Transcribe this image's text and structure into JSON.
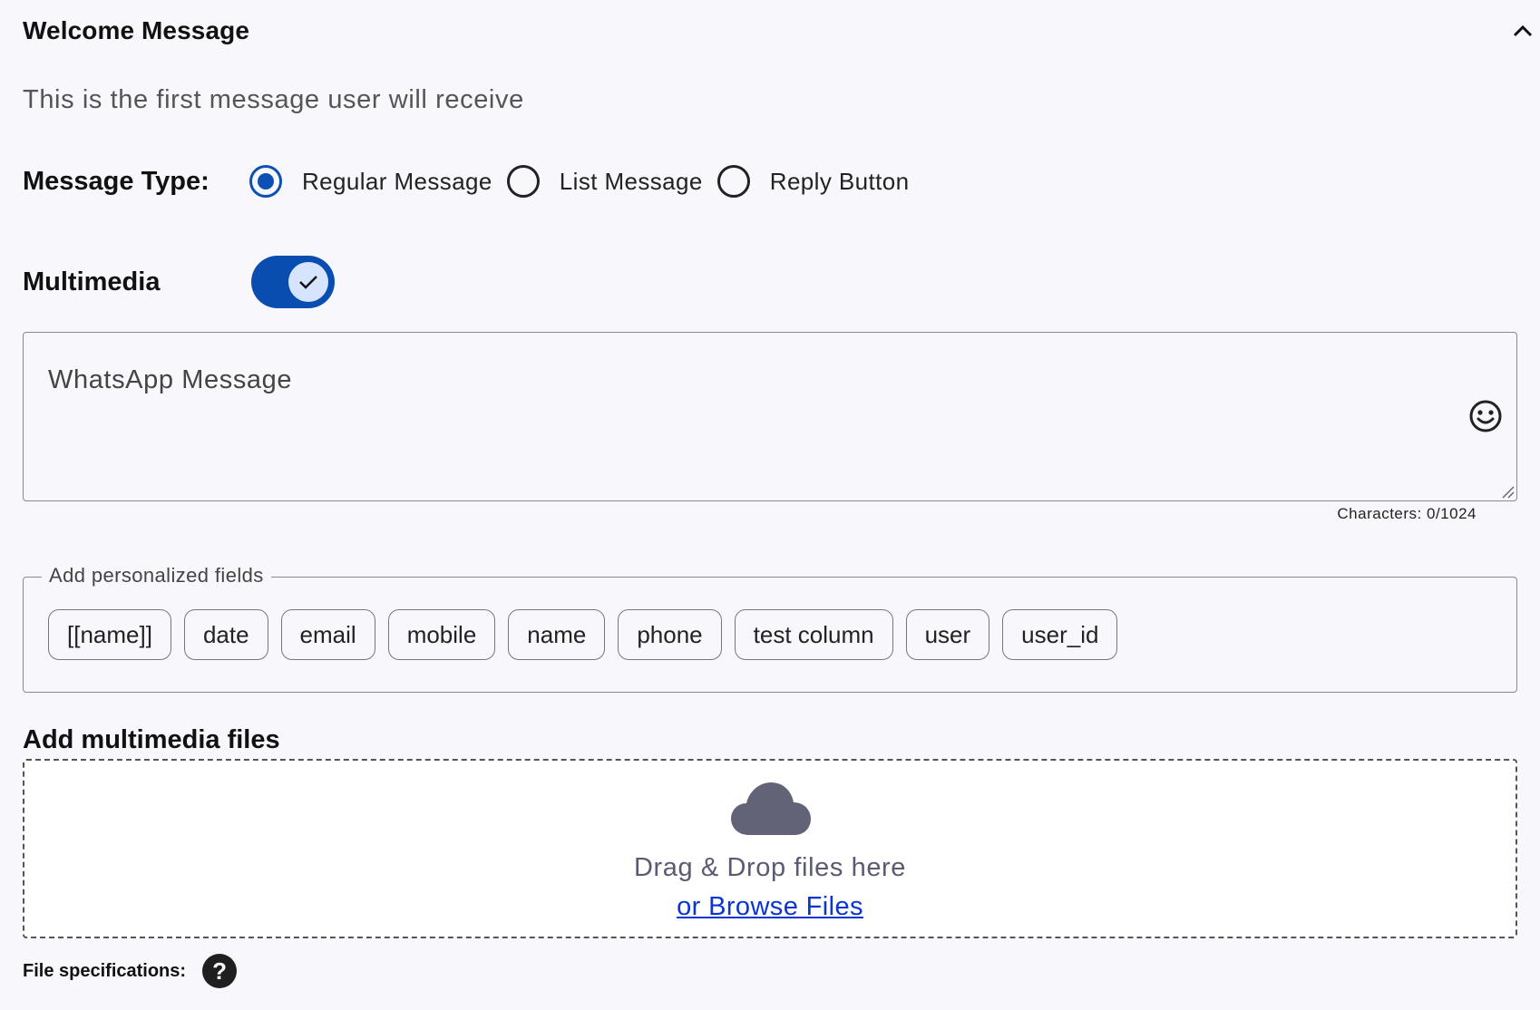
{
  "section": {
    "title": "Welcome Message",
    "subtitle": "This is the first message user will receive",
    "collapse_icon": "chevron-up-icon"
  },
  "message_type": {
    "label": "Message Type:",
    "options": [
      {
        "label": "Regular Message",
        "selected": true
      },
      {
        "label": "List Message",
        "selected": false
      },
      {
        "label": "Reply Button",
        "selected": false
      }
    ]
  },
  "multimedia": {
    "label": "Multimedia",
    "enabled": true
  },
  "message_input": {
    "placeholder": "WhatsApp Message",
    "value": "",
    "emoji_icon": "smile-icon",
    "char_count": "Characters: 0/1024"
  },
  "personalized_fields": {
    "legend": "Add personalized fields",
    "chips": [
      "[[name]]",
      "date",
      "email",
      "mobile",
      "name",
      "phone",
      "test column",
      "user",
      "user_id"
    ]
  },
  "multimedia_files": {
    "title": "Add multimedia files",
    "upload_icon": "cloud-icon",
    "drag_text": "Drag & Drop files here",
    "browse_text": "or Browse Files"
  },
  "file_spec": {
    "label": "File specifications:",
    "help_icon": "?"
  },
  "colors": {
    "accent": "#0a4db0",
    "background": "#f8f8fc",
    "link": "#0a34d6"
  }
}
